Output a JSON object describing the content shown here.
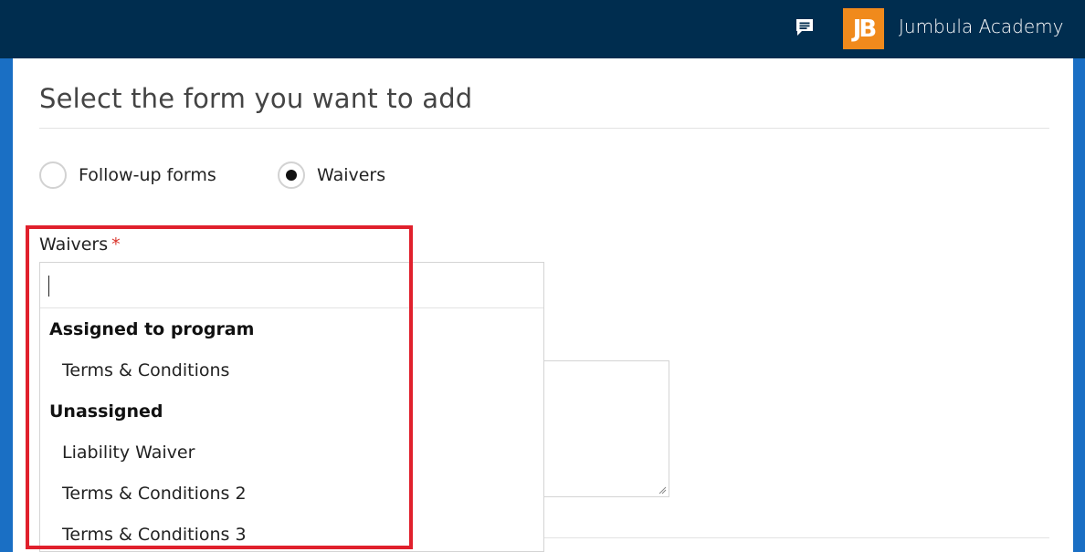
{
  "header": {
    "chat_icon": "chat-bubble-icon",
    "logo_text": "JB",
    "org_name": "Jumbula Academy",
    "colors": {
      "bar": "#002d4f",
      "logo": "#f08a1c"
    }
  },
  "page": {
    "title": "Select the form you want to add"
  },
  "form_type": {
    "options": [
      {
        "label": "Follow-up forms",
        "checked": false
      },
      {
        "label": "Waivers",
        "checked": true
      }
    ]
  },
  "waivers_field": {
    "label": "Waivers",
    "required_mark": "*",
    "search_value": "",
    "groups": [
      {
        "header": "Assigned to program",
        "items": [
          "Terms & Conditions"
        ]
      },
      {
        "header": "Unassigned",
        "items": [
          "Liability Waiver",
          "Terms & Conditions 2",
          "Terms & Conditions 3"
        ]
      }
    ]
  },
  "annotation": {
    "highlight_color": "#e0202c"
  }
}
